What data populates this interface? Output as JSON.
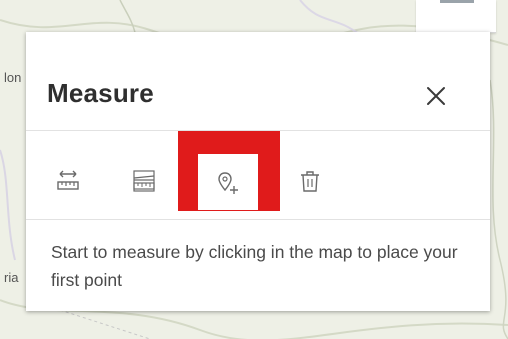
{
  "map": {
    "labels": [
      "lon",
      "ria"
    ]
  },
  "panel": {
    "title": "Measure",
    "close_icon": "close-icon",
    "tools": [
      {
        "name": "distance",
        "icon": "measure-distance-icon",
        "active": false
      },
      {
        "name": "area",
        "icon": "measure-area-icon",
        "active": false
      },
      {
        "name": "location",
        "icon": "location-pin-plus-icon",
        "active": true
      },
      {
        "name": "clear",
        "icon": "trash-icon",
        "active": false
      }
    ],
    "message": "Start to measure by clicking in the map to place your first point"
  },
  "colors": {
    "highlight": "#e01b1b",
    "icon": "#6a6a6a",
    "title": "#2f2f2f"
  }
}
